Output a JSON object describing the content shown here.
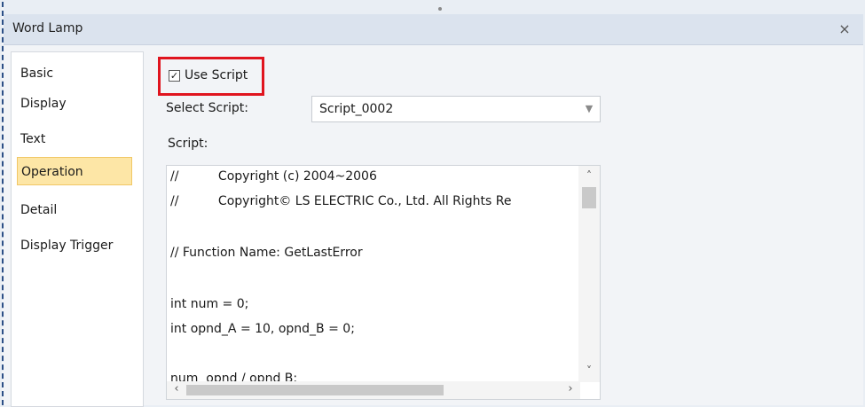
{
  "window": {
    "title": "Word Lamp",
    "close_glyph": "×"
  },
  "sidebar": {
    "items": [
      {
        "label": "Basic",
        "active": false
      },
      {
        "label": "Display",
        "active": false
      },
      {
        "label": "Text",
        "active": false
      },
      {
        "label": "Operation",
        "active": true
      },
      {
        "label": "Detail",
        "active": false
      },
      {
        "label": "Display Trigger",
        "active": false
      }
    ]
  },
  "operation": {
    "use_script": {
      "label": "Use Script",
      "checked": true
    },
    "select_script": {
      "label": "Select Script:",
      "value": "Script_0002"
    },
    "script_label": "Script:",
    "script_lines": [
      "//          Copyright (c) 2004~2006",
      "//          Copyright© LS ELECTRIC Co., Ltd. All Rights Re",
      "",
      "// Function Name: GetLastError",
      "",
      "int num = 0;",
      "int opnd_A = 10, opnd_B = 0;",
      "",
      "num  opnd / opnd B;"
    ]
  },
  "colors": {
    "highlight_border": "#e0141e",
    "active_nav_bg": "#fde6a6"
  }
}
